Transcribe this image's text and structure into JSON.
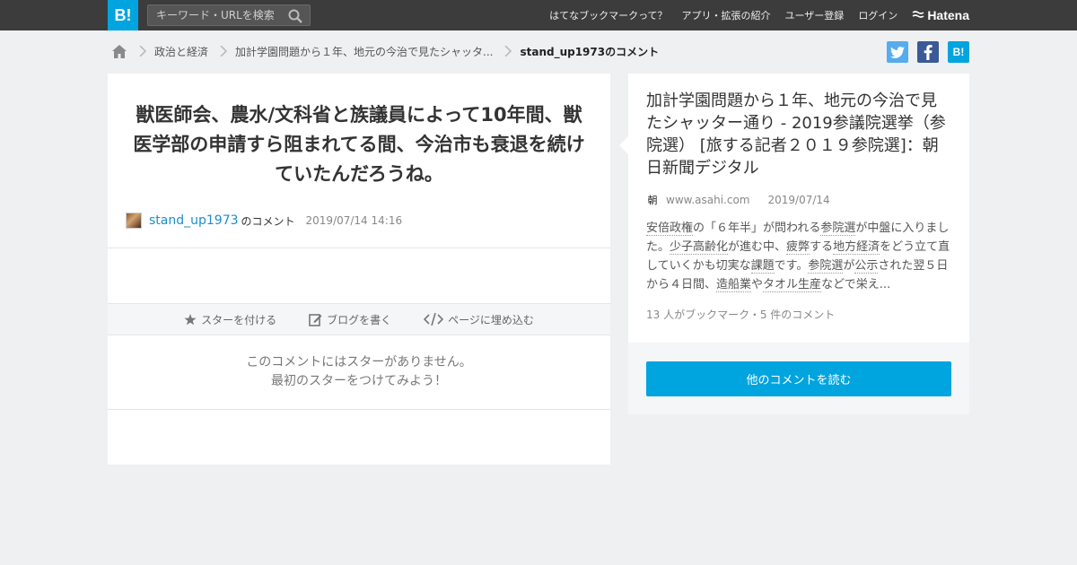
{
  "topbar": {
    "logo": "B!",
    "search_placeholder": "キーワード・URLを検索",
    "nav": [
      "はてなブックマークって？",
      "アプリ・拡張の紹介",
      "ユーザー登録",
      "ログイン"
    ],
    "brand": "Hatena"
  },
  "breadcrumb": {
    "items": [
      "政治と経済",
      "加計学園問題から１年、地元の今治で見たシャッタ...",
      "stand_up1973のコメント"
    ]
  },
  "share": {
    "twitter_color": "#55acee",
    "facebook_color": "#3b5998",
    "hatena_color": "#00a4de",
    "hatena_label": "B!"
  },
  "comment": {
    "body": "獣医師会、農水/文科省と族議員によって10年間、獣医学部の申請すら阻まれてる間、今治市も衰退を続けていたんだろうね。",
    "user": "stand_up1973",
    "suffix": "のコメント",
    "timestamp": "2019/07/14 14:16"
  },
  "actions": {
    "star": "スターを付ける",
    "blog": "ブログを書く",
    "embed": "ページに埋め込む"
  },
  "stars": {
    "line1": "このコメントにはスターがありません。",
    "line2": "最初のスターをつけてみよう！"
  },
  "entry": {
    "title": "加計学園問題から１年、地元の今治で見たシャッター通り - 2019参議院選挙（参院選） [旅する記者２０１９参院選]：朝日新聞デジタル",
    "domain": "www.asahi.com",
    "date": "2019/07/14",
    "summary": [
      {
        "t": "安倍政権",
        "kw": true
      },
      {
        "t": "の「６年半」が問われる",
        "kw": false
      },
      {
        "t": "参院選",
        "kw": true
      },
      {
        "t": "が中盤に入りました。",
        "kw": false
      },
      {
        "t": "少子高齢化",
        "kw": true
      },
      {
        "t": "が進む中、",
        "kw": false
      },
      {
        "t": "疲弊",
        "kw": true
      },
      {
        "t": "する",
        "kw": false
      },
      {
        "t": "地方経済",
        "kw": true
      },
      {
        "t": "をどう立て直していくかも切実な",
        "kw": false
      },
      {
        "t": "課題",
        "kw": true
      },
      {
        "t": "です。",
        "kw": false
      },
      {
        "t": "参院選",
        "kw": true
      },
      {
        "t": "が",
        "kw": false
      },
      {
        "t": "公示",
        "kw": true
      },
      {
        "t": "された翌５日から４日間、",
        "kw": false
      },
      {
        "t": "造船業",
        "kw": true
      },
      {
        "t": "や",
        "kw": false
      },
      {
        "t": "タオル生産",
        "kw": true
      },
      {
        "t": "などで栄え...",
        "kw": false
      }
    ],
    "stats": "13 人がブックマーク・5 件のコメント"
  },
  "more_button": "他のコメントを読む"
}
